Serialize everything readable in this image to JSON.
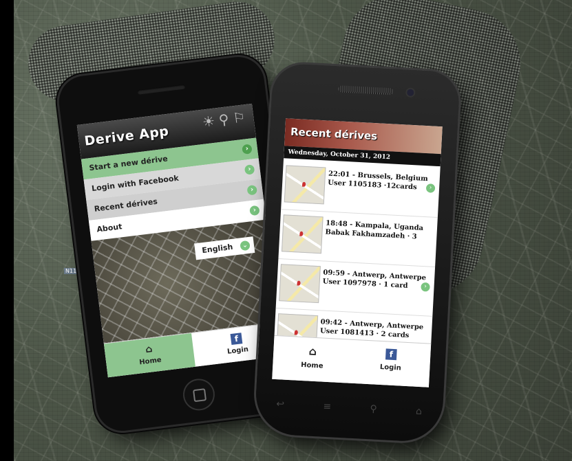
{
  "left_phone": {
    "app_title": "Derive App",
    "menu": [
      {
        "label": "Start a new dérive"
      },
      {
        "label": "Login with Facebook"
      },
      {
        "label": "Recent dérives"
      },
      {
        "label": "About"
      }
    ],
    "language_label": "English",
    "tabs": [
      {
        "label": "Home",
        "icon": "home-icon"
      },
      {
        "label": "Login",
        "icon": "facebook-icon"
      }
    ]
  },
  "right_phone": {
    "title": "Recent dérives",
    "date": "Wednesday, October 31, 2012",
    "entries": [
      {
        "line1": "22:01 - Brussels, Belgium",
        "line2": "User 1105183 ·12cards"
      },
      {
        "line1": "18:48 - Kampala, Uganda",
        "line2": "Babak Fakhamzadeh · 3"
      },
      {
        "line1": "09:59 - Antwerp, Antwerpe",
        "line2": "User 1097978 · 1 card"
      },
      {
        "line1": "09:42 - Antwerp, Antwerpe",
        "line2": "User 1081413 · 2 cards"
      }
    ],
    "tabs": [
      {
        "label": "Home",
        "icon": "home-icon"
      },
      {
        "label": "Login",
        "icon": "facebook-icon"
      }
    ]
  },
  "map_labels": [
    "N113"
  ],
  "colors": {
    "accent_green": "#8dc58f",
    "header_red": "#7a2b22",
    "facebook_blue": "#3b5998"
  }
}
